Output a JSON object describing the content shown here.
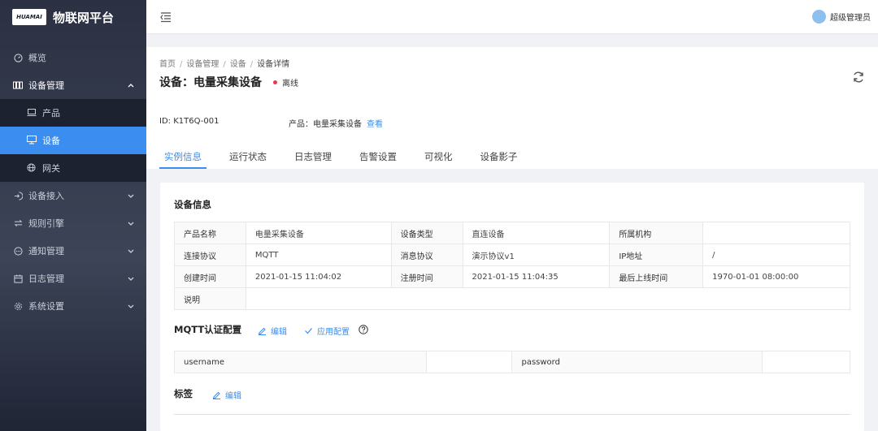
{
  "app": {
    "logo_text": "HUAMAI",
    "title": "物联网平台"
  },
  "sidebar": {
    "overview": "概览",
    "device_mgmt": "设备管理",
    "product": "产品",
    "device": "设备",
    "gateway": "网关",
    "device_access": "设备接入",
    "rule_engine": "规则引擎",
    "notify_mgmt": "通知管理",
    "log_mgmt": "日志管理",
    "system_settings": "系统设置"
  },
  "header": {
    "user_name": "超级管理员"
  },
  "breadcrumb": [
    "首页",
    "设备管理",
    "设备",
    "设备详情"
  ],
  "device": {
    "title": "设备：电量采集设备",
    "status": "离线",
    "id_label": "ID:",
    "id_value": "K1T6Q-001",
    "product_label": "产品：",
    "product_value": "电量采集设备",
    "view_link": "查看"
  },
  "tabs": [
    "实例信息",
    "运行状态",
    "日志管理",
    "告警设置",
    "可视化",
    "设备影子"
  ],
  "device_info": {
    "section_title": "设备信息",
    "rows": [
      [
        "产品名称",
        "电量采集设备",
        "设备类型",
        "直连设备",
        "所属机构",
        ""
      ],
      [
        "连接协议",
        "MQTT",
        "消息协议",
        "演示协议v1",
        "IP地址",
        "/"
      ],
      [
        "创建时间",
        "2021-01-15 11:04:02",
        "注册时间",
        "2021-01-15 11:04:35",
        "最后上线时间",
        "1970-01-01 08:00:00"
      ],
      [
        "说明",
        ""
      ]
    ]
  },
  "mqtt": {
    "section_title": "MQTT认证配置",
    "edit": "编辑",
    "apply": "应用配置",
    "username_label": "username",
    "username_value": "",
    "password_label": "password",
    "password_value": ""
  },
  "tags": {
    "section_title": "标签",
    "edit": "编辑"
  },
  "colors": {
    "primary": "#3b8ef0",
    "offline_dot": "#e8384f",
    "sidebar_bg": "#2b3142"
  }
}
